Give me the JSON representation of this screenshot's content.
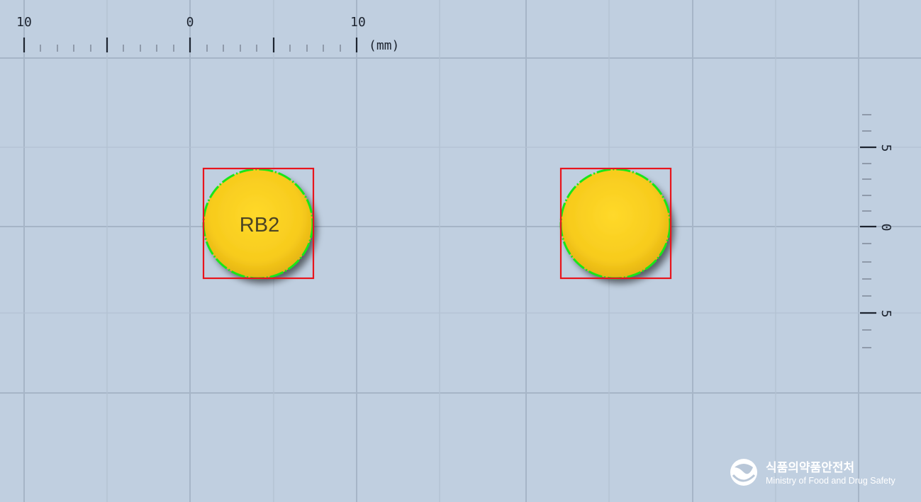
{
  "ruler": {
    "top_labels": [
      "10",
      "0",
      "10"
    ],
    "unit": "(mm)",
    "right_labels": [
      "5",
      "0",
      "5"
    ]
  },
  "tablets": [
    {
      "imprint": "RB2",
      "color": "#f4c71c"
    },
    {
      "imprint": "",
      "color": "#f4c71c"
    }
  ],
  "logo": {
    "korean": "식품의약품안전처",
    "english": "Ministry of Food and Drug Safety"
  },
  "colors": {
    "background": "#c0cfe0",
    "grid_line": "#a9b8c9",
    "bounding_box": "#e8141c",
    "contour": "#19e619",
    "tablet_fill": "#f4c71c"
  }
}
